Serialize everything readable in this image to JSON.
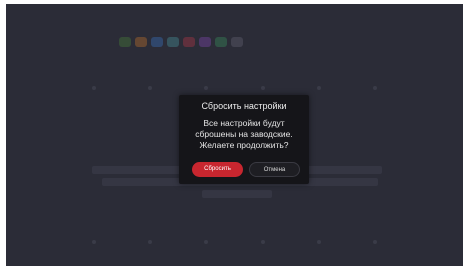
{
  "dialog": {
    "title": "Сбросить настройки",
    "message_lines": [
      "Все настройки будут",
      "сброшены на заводские.",
      "Желаете продолжить?"
    ],
    "confirm_label": "Сбросить",
    "cancel_label": "Отмена"
  },
  "colors": {
    "screen_bg": "#2b2c37",
    "dialog_bg": "#151519",
    "confirm_accent": "#c8262f"
  },
  "background_icons": [
    "#4a8a3a",
    "#d27b2a",
    "#3a7ad0",
    "#4aa0a8",
    "#c23a4a",
    "#8a4ac0",
    "#3a9a60",
    "#6a6a7a"
  ]
}
